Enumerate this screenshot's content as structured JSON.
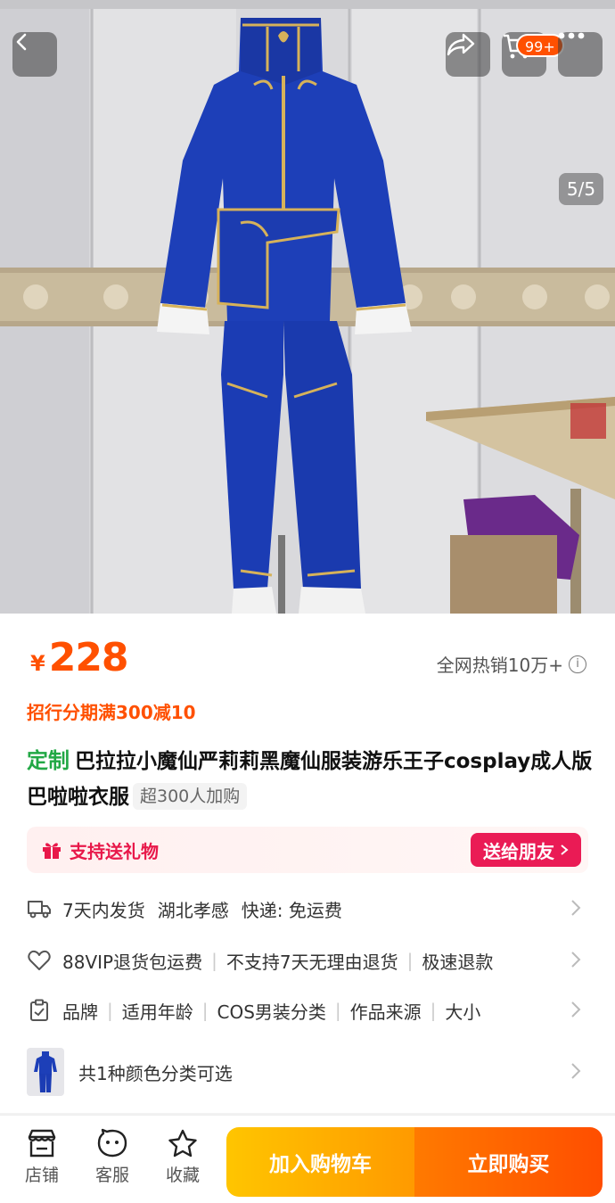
{
  "header": {
    "cart_badge": "99+",
    "pager": "5/5"
  },
  "product": {
    "currency": "¥",
    "price": "228",
    "sales": "全网热销10万+",
    "promo": "招行分期满300减10",
    "custom_tag": "定制",
    "title": "巴拉拉小魔仙严莉莉黑魔仙服装游乐王子cosplay成人版巴啦啦衣服",
    "add_chip": "超300人加购"
  },
  "gift": {
    "label": "支持送礼物",
    "button": "送给朋友"
  },
  "rows": {
    "shipping": [
      "7天内发货",
      "湖北孝感",
      "快递: 免运费"
    ],
    "service": [
      "88VIP退货包运费",
      "不支持7天无理由退货",
      "极速退款"
    ],
    "params": [
      "品牌",
      "适用年龄",
      "COS男装分类",
      "作品来源",
      "大小"
    ],
    "sku": "共1种颜色分类可选"
  },
  "bottom": {
    "shop": "店铺",
    "service": "客服",
    "fav": "收藏",
    "add_cart": "加入购物车",
    "buy_now": "立即购买"
  },
  "colors": {
    "accent": "#ff5000",
    "gift": "#ea1b55",
    "costume_blue": "#1d3fb8",
    "trim_gold": "#d6b25a"
  }
}
